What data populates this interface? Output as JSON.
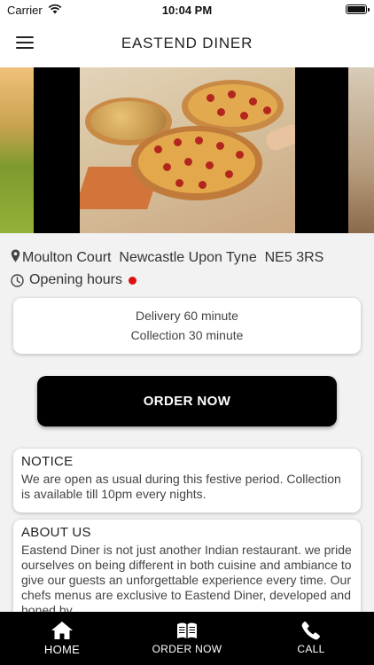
{
  "status_bar": {
    "carrier": "Carrier",
    "time": "10:04 PM"
  },
  "header": {
    "title": "EASTEND DINER",
    "menu_icon": "hamburger-menu-icon"
  },
  "banner": {
    "image": "pizza-photo"
  },
  "location": {
    "address": "Moulton Court  Newcastle Upon Tyne  NE5 3RS",
    "opening_hours_label": "Opening hours",
    "status_color": "#dd1111"
  },
  "times": {
    "delivery": "Delivery 60 minute",
    "collection": "Collection 30 minute"
  },
  "order_button": {
    "label": "ORDER NOW"
  },
  "notice": {
    "title": "NOTICE",
    "text": "We are open as usual during this festive period. Collection is available till 10pm every nights."
  },
  "about": {
    "title": "ABOUT US",
    "text": "Eastend Diner is not just another Indian restaurant. we pride ourselves on being different in both cuisine and ambiance to give our guests an unforgettable experience every time.  Our chefs menus are exclusive to Eastend Diner, developed and honed by"
  },
  "tabbar": {
    "background": "#000000",
    "items": [
      {
        "label": "HOME",
        "icon": "home-icon"
      },
      {
        "label": "ORDER NOW",
        "icon": "book-menu-icon"
      },
      {
        "label": "CALL",
        "icon": "phone-icon"
      }
    ]
  }
}
